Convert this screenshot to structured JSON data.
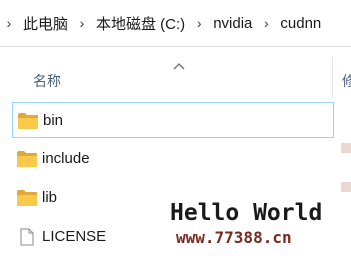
{
  "address_bar": {
    "crumbs": [
      "此电脑",
      "本地磁盘 (C:)",
      "nvidia",
      "cudnn"
    ]
  },
  "column_header": {
    "name_label": "名称",
    "next_label_partial": "修"
  },
  "files": [
    {
      "name": "bin",
      "type": "folder",
      "selected": true
    },
    {
      "name": "include",
      "type": "folder",
      "selected": false
    },
    {
      "name": "lib",
      "type": "folder",
      "selected": false
    },
    {
      "name": "LICENSE",
      "type": "file",
      "selected": false
    }
  ],
  "watermark": {
    "line1": "Hello World",
    "line2": "www.77388.cn"
  },
  "colors": {
    "folder_yellow": "#f8c94b",
    "folder_dark": "#e0a93a",
    "header_text": "#4c607a",
    "selection_border": "#99d1ff"
  }
}
